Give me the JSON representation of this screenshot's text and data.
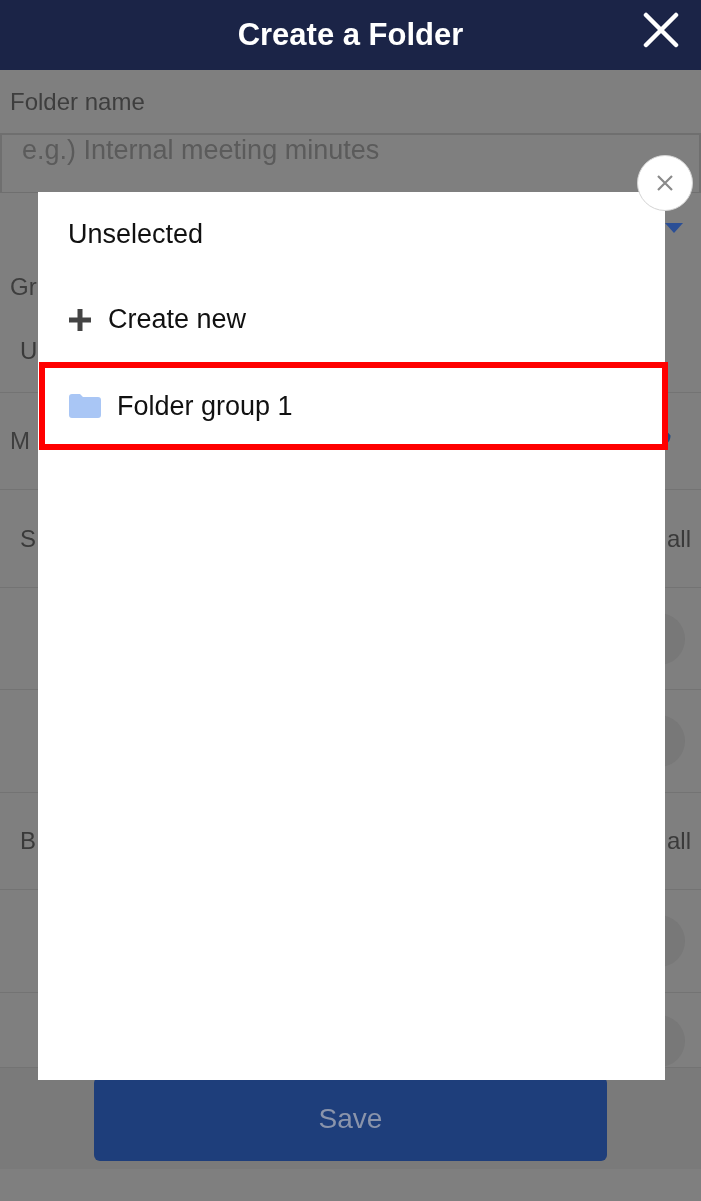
{
  "header": {
    "title": "Create a Folder"
  },
  "form": {
    "rows": [
      {
        "kind": "label",
        "text": "Folder name"
      },
      {
        "kind": "input",
        "placeholder": "e.g.) Internal meeting minutes"
      },
      {
        "kind": "select"
      },
      {
        "kind": "label",
        "text": "Gr"
      },
      {
        "kind": "value",
        "text": "U"
      },
      {
        "kind": "help",
        "text": "M"
      },
      {
        "kind": "pair",
        "text": "S",
        "trailing": "all"
      },
      {
        "kind": "toggle",
        "on": false
      },
      {
        "kind": "toggle",
        "on": false
      },
      {
        "kind": "pair",
        "text": "B",
        "trailing": "all"
      },
      {
        "kind": "toggle",
        "on": false
      },
      {
        "kind": "member",
        "on": false
      }
    ]
  },
  "save_button": "Save",
  "picker": {
    "items": [
      {
        "kind": "plain",
        "label": "Unselected",
        "highlighted": false
      },
      {
        "kind": "create",
        "label": "Create new",
        "highlighted": false
      },
      {
        "kind": "folder",
        "label": "Folder group 1",
        "highlighted": true
      }
    ]
  }
}
